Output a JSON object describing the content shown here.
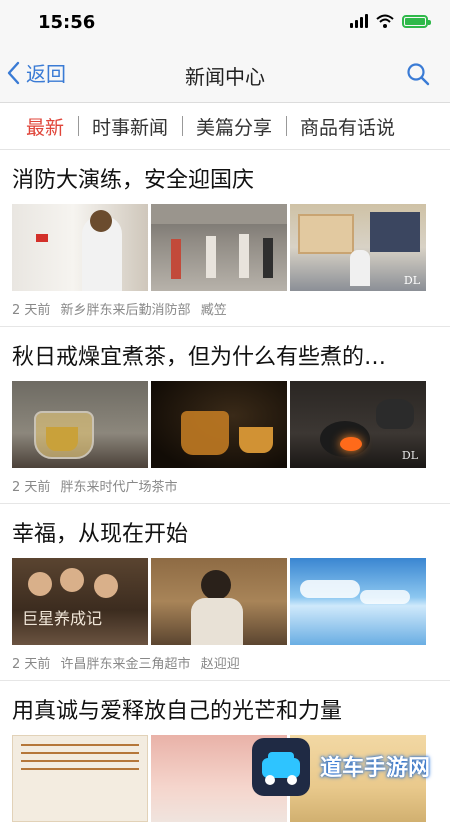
{
  "status": {
    "time": "15:56"
  },
  "nav": {
    "back_label": "返回",
    "title": "新闻中心"
  },
  "tabs": [
    "最新",
    "时事新闻",
    "美篇分享",
    "商品有话说"
  ],
  "news": [
    {
      "title": "消防大演练，安全迎国庆",
      "time": "2 天前",
      "source": "新乡胖东来后勤消防部",
      "author": "臧笠"
    },
    {
      "title": "秋日戒燥宜煮茶，但为什么有些煮的…",
      "time": "2 天前",
      "source": "胖东来时代广场茶市",
      "author": ""
    },
    {
      "title": "幸福，从现在开始",
      "time": "2 天前",
      "source": "许昌胖东来金三角超市",
      "author": "赵迎迎"
    },
    {
      "title": "用真诚与爱释放自己的光芒和力量",
      "time": "",
      "source": "",
      "author": ""
    }
  ],
  "watermark": {
    "text": "道车手游网"
  }
}
